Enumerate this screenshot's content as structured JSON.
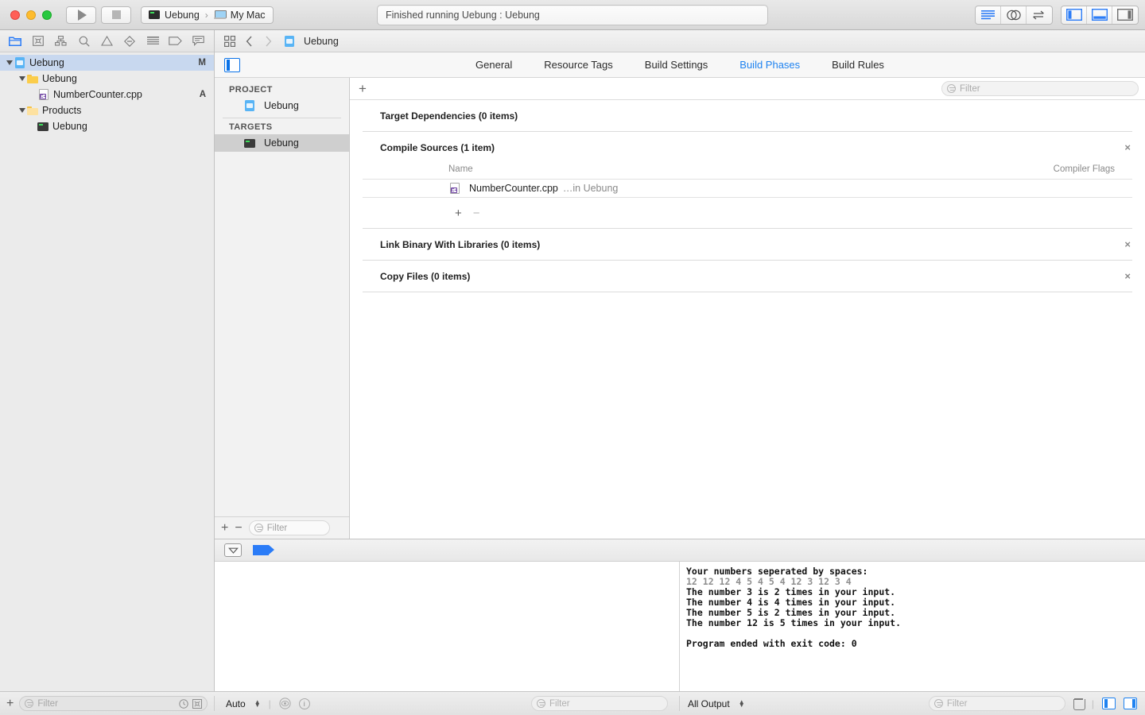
{
  "titlebar": {
    "run_tooltip": "Run",
    "stop_tooltip": "Stop",
    "scheme_name": "Uebung",
    "scheme_separator": "›",
    "destination": "My Mac",
    "status": "Finished running Uebung : Uebung"
  },
  "navigator": {
    "toolbar_icons": [
      "folder-icon",
      "source-control-icon",
      "symbol-icon",
      "search-icon",
      "warning-icon",
      "test-icon",
      "debug-icon",
      "breakpoint-icon",
      "report-icon"
    ],
    "tree": [
      {
        "label": "Uebung",
        "icon": "xcodeproj-icon",
        "depth": 0,
        "disclosure": "open",
        "status": "M",
        "selected": true
      },
      {
        "label": "Uebung",
        "icon": "folder-icon",
        "depth": 1,
        "disclosure": "open",
        "status": "",
        "selected": false
      },
      {
        "label": "NumberCounter.cpp",
        "icon": "cpp-file-icon",
        "depth": 2,
        "disclosure": "none",
        "status": "A",
        "selected": false
      },
      {
        "label": "Products",
        "icon": "folder-light-icon",
        "depth": 1,
        "disclosure": "open",
        "status": "",
        "selected": false
      },
      {
        "label": "Uebung",
        "icon": "executable-icon",
        "depth": 2,
        "disclosure": "none",
        "status": "",
        "selected": false
      }
    ],
    "filter_placeholder": "Filter"
  },
  "jumpbar": {
    "breadcrumb": "Uebung"
  },
  "editor": {
    "tabs": [
      {
        "label": "General",
        "active": false
      },
      {
        "label": "Resource Tags",
        "active": false
      },
      {
        "label": "Build Settings",
        "active": false
      },
      {
        "label": "Build Phases",
        "active": true
      },
      {
        "label": "Build Rules",
        "active": false
      }
    ],
    "accent_color": "#1e82f0"
  },
  "targets_pane": {
    "project_header": "PROJECT",
    "project_item": "Uebung",
    "targets_header": "TARGETS",
    "target_item": "Uebung",
    "add_label": "+",
    "remove_label": "−",
    "filter_placeholder": "Filter"
  },
  "build_phases": {
    "add_phase_label": "+",
    "filter_placeholder": "Filter",
    "phases": [
      {
        "title": "Target Dependencies (0 items)",
        "expanded": false,
        "removable": false
      },
      {
        "title": "Compile Sources (1 item)",
        "expanded": true,
        "removable": true
      },
      {
        "title": "Link Binary With Libraries (0 items)",
        "expanded": false,
        "removable": true
      },
      {
        "title": "Copy Files (0 items)",
        "expanded": false,
        "removable": true
      }
    ],
    "compile_sources": {
      "col_name": "Name",
      "col_flags": "Compiler Flags",
      "files": [
        {
          "name": "NumberCounter.cpp",
          "location": "…in Uebung"
        }
      ],
      "add_label": "+",
      "remove_label": "−"
    },
    "remove_glyph": "×"
  },
  "debug_area": {
    "toolbar_icons": [
      "hide-console-icon",
      "breakpoint-activate-icon"
    ],
    "console_lines": [
      {
        "text": "Your numbers seperated by spaces:",
        "style": "output"
      },
      {
        "text": "12 12 12 4 5 4 5 4 12 3 12 3 4",
        "style": "echo"
      },
      {
        "text": "The number 3 is 2 times in your input.",
        "style": "output"
      },
      {
        "text": "The number 4 is 4 times in your input.",
        "style": "output"
      },
      {
        "text": "The number 5 is 2 times in your input.",
        "style": "output"
      },
      {
        "text": "The number 12 is 5 times in your input.",
        "style": "output"
      },
      {
        "text": "",
        "style": "output"
      },
      {
        "text": "Program ended with exit code: 0",
        "style": "output"
      }
    ]
  },
  "bottombar": {
    "nav_add_label": "+",
    "nav_filter_placeholder": "Filter",
    "variables_scope": "Auto",
    "variables_filter_placeholder": "Filter",
    "output_scope": "All Output",
    "output_filter_placeholder": "Filter"
  }
}
